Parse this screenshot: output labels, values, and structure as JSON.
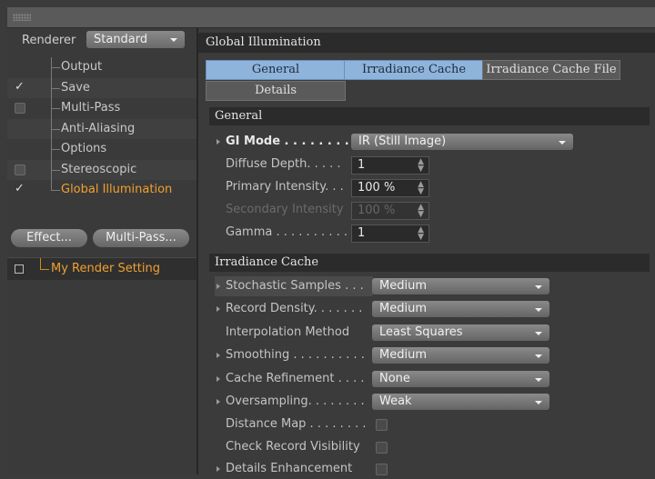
{
  "renderer": {
    "label": "Renderer",
    "value": "Standard"
  },
  "tree": [
    {
      "label": "Output",
      "check": "none"
    },
    {
      "label": "Save",
      "check": "tick"
    },
    {
      "label": "Multi-Pass",
      "check": "box"
    },
    {
      "label": "Anti-Aliasing",
      "check": "none"
    },
    {
      "label": "Options",
      "check": "none"
    },
    {
      "label": "Stereoscopic",
      "check": "box"
    },
    {
      "label": "Global Illumination",
      "check": "tick"
    }
  ],
  "buttons": {
    "effect": "Effect...",
    "multipass": "Multi-Pass..."
  },
  "render_setting": "My Render Setting",
  "panel_title": "Global Illumination",
  "tabs": {
    "general": "General",
    "irradiance_cache": "Irradiance Cache",
    "irradiance_cache_file": "Irradiance Cache File",
    "details": "Details"
  },
  "general": {
    "title": "General",
    "gi_mode": {
      "label": "GI Mode . . . . . . . . .",
      "value": "IR (Still Image)"
    },
    "diffuse_depth": {
      "label": "Diffuse Depth. . . . .",
      "value": "1"
    },
    "primary_intensity": {
      "label": "Primary Intensity. . .",
      "value": "100 %"
    },
    "secondary_intensity": {
      "label": "Secondary Intensity",
      "value": "100 %"
    },
    "gamma": {
      "label": "Gamma . . . . . . . . . .",
      "value": "1"
    }
  },
  "irradiance": {
    "title": "Irradiance Cache",
    "stochastic": {
      "label": "Stochastic Samples . . .",
      "value": "Medium"
    },
    "record_density": {
      "label": "Record Density. . . . . . .",
      "value": "Medium"
    },
    "interpolation": {
      "label": "Interpolation Method",
      "value": "Least Squares"
    },
    "smoothing": {
      "label": "Smoothing . . . . . . . . . .",
      "value": "Medium"
    },
    "cache_refinement": {
      "label": "Cache Refinement . . . .",
      "value": "None"
    },
    "oversampling": {
      "label": "Oversampling. . . . . . . .",
      "value": "Weak"
    },
    "distance_map": {
      "label": "Distance Map . . . . . . . ."
    },
    "check_record_visibility": {
      "label": "Check Record Visibility"
    },
    "details_enhancement": {
      "label": "Details Enhancement"
    }
  }
}
